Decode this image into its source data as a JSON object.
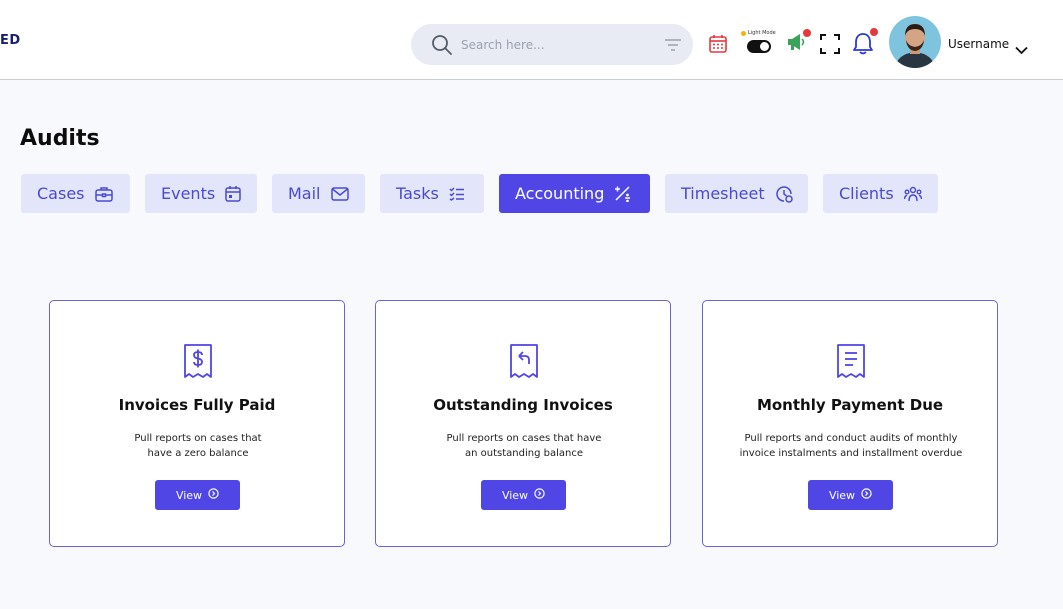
{
  "header": {
    "logo_text": "ED",
    "search_placeholder": "Search here...",
    "mode_label": "Light Mode",
    "username": "Username"
  },
  "page": {
    "title": "Audits"
  },
  "tabs": [
    {
      "label": "Cases",
      "icon": "briefcase-icon",
      "active": false
    },
    {
      "label": "Events",
      "icon": "calendar-icon",
      "active": false
    },
    {
      "label": "Mail",
      "icon": "mail-icon",
      "active": false
    },
    {
      "label": "Tasks",
      "icon": "checklist-icon",
      "active": false
    },
    {
      "label": "Accounting",
      "icon": "calculator-icon",
      "active": true
    },
    {
      "label": "Timesheet",
      "icon": "clock-icon",
      "active": false
    },
    {
      "label": "Clients",
      "icon": "people-icon",
      "active": false
    }
  ],
  "cards": [
    {
      "title": "Invoices Fully Paid",
      "desc_line1": "Pull reports on cases that",
      "desc_line2": "have a zero balance",
      "button": "View",
      "icon": "receipt-dollar-icon"
    },
    {
      "title": "Outstanding Invoices",
      "desc_line1": "Pull reports on cases that have",
      "desc_line2": "an outstanding balance",
      "button": "View",
      "icon": "receipt-return-icon"
    },
    {
      "title": "Monthly Payment Due",
      "desc_line1": "Pull reports and conduct audits of monthly",
      "desc_line2": "invoice instalments and installment overdue",
      "button": "View",
      "icon": "receipt-lines-icon"
    }
  ],
  "colors": {
    "accent": "#4f46e5",
    "tab_bg": "#e3e6fb",
    "notification": "#e5383b"
  }
}
